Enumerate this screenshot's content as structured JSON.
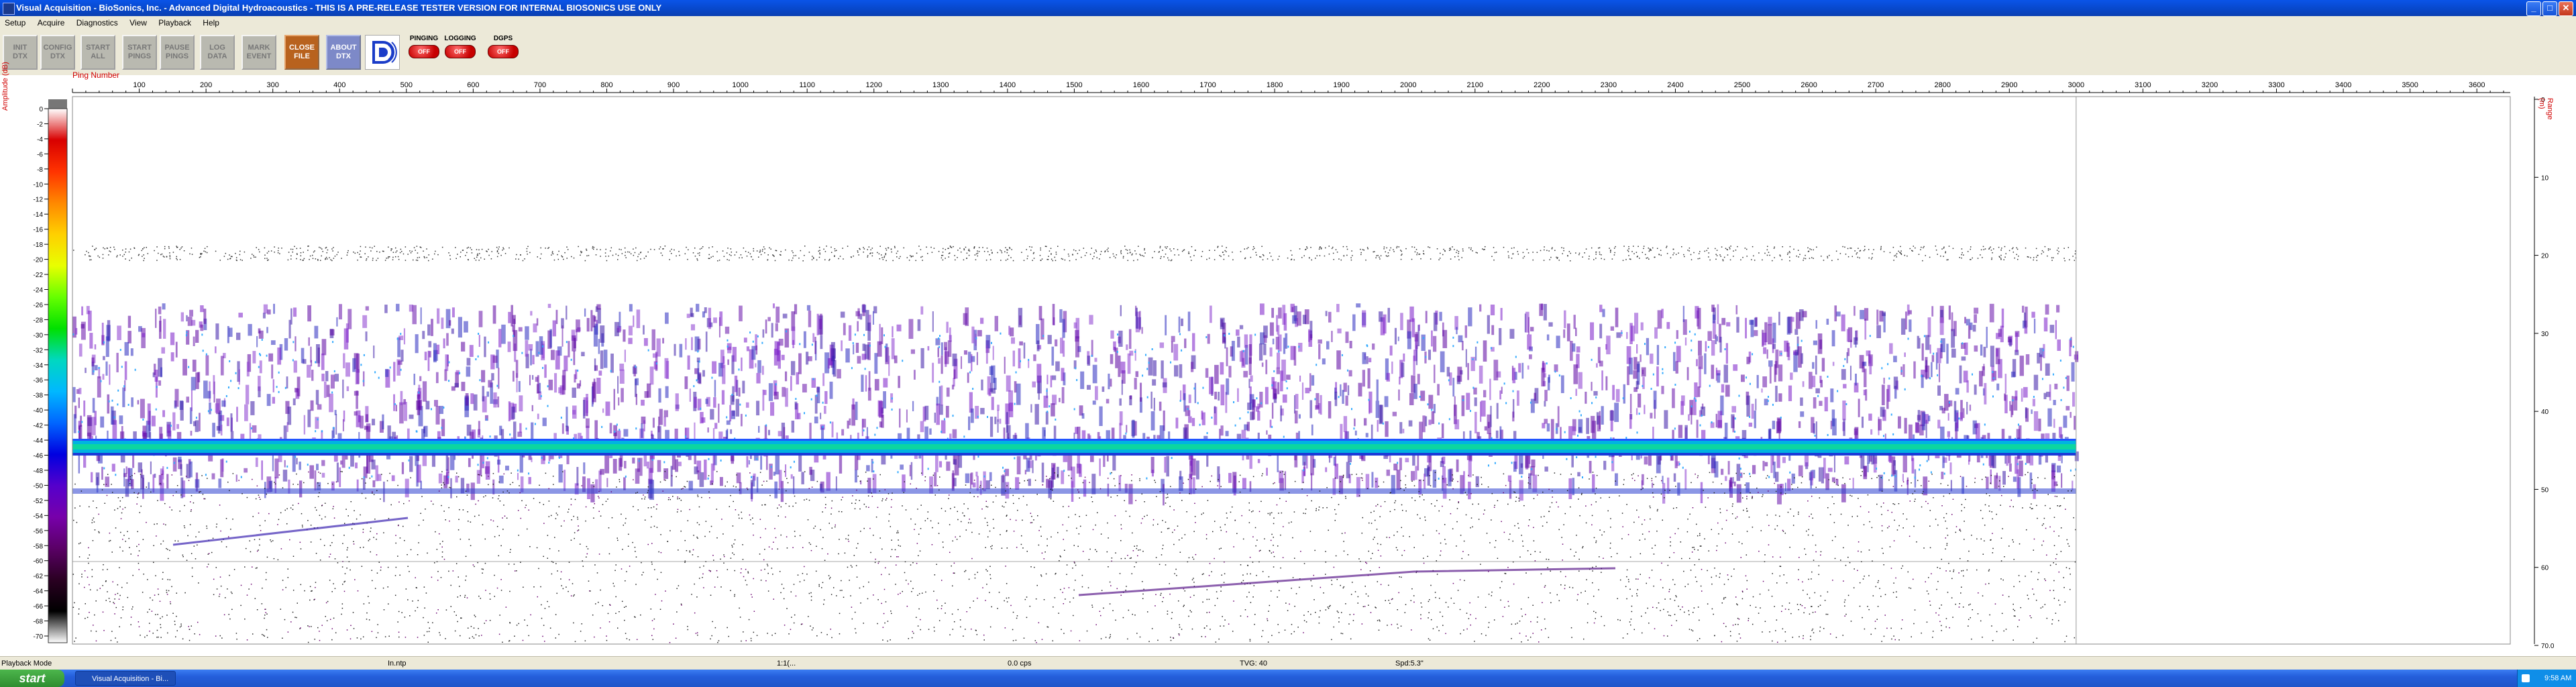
{
  "window": {
    "title": "Visual Acquisition  -  BioSonics, Inc.  -  Advanced Digital Hydroacoustics  -  THIS IS A PRE-RELEASE TESTER VERSION FOR INTERNAL BIOSONICS USE ONLY"
  },
  "menu": [
    "Setup",
    "Acquire",
    "Diagnostics",
    "View",
    "Playback",
    "Help"
  ],
  "toolbar": {
    "buttons": [
      {
        "label": "INIT\nDTX"
      },
      {
        "label": "CONFIG\nDTX"
      },
      {
        "label": "START\nALL"
      },
      {
        "label": "START\nPINGS"
      },
      {
        "label": "PAUSE\nPINGS"
      },
      {
        "label": "LOG\nDATA"
      },
      {
        "label": "MARK\nEVENT"
      },
      {
        "label": "CLOSE\nFILE"
      },
      {
        "label": "ABOUT\nDTX"
      }
    ],
    "indicators": [
      {
        "label": "PINGING",
        "state": "OFF"
      },
      {
        "label": "LOGGING",
        "state": "OFF"
      },
      {
        "label": "DGPS",
        "state": "OFF"
      }
    ]
  },
  "plot": {
    "x_title": "Ping Number",
    "left_title": "Amplitude (dB)",
    "right_title": "Range (m)",
    "x_ticks": [
      100,
      200,
      300,
      400,
      500,
      600,
      700,
      800,
      900,
      1000,
      1100,
      1200,
      1300,
      1400,
      1500,
      1600,
      1700,
      1800,
      1900,
      2000,
      2100,
      2200,
      2300,
      2400,
      2500,
      2600,
      2700,
      2800,
      2900,
      3000,
      3100,
      3200,
      3300,
      3400,
      3500,
      3600
    ],
    "amp_ticks": [
      "0",
      "-2",
      "-4",
      "-6",
      "-8",
      "-10",
      "-12",
      "-14",
      "-16",
      "-18",
      "-20",
      "-22",
      "-24",
      "-26",
      "-28",
      "-30",
      "-32",
      "-34",
      "-36",
      "-38",
      "-40",
      "-42",
      "-44",
      "-46",
      "-48",
      "-50",
      "-52",
      "-54",
      "-56",
      "-58",
      "-60",
      "-62",
      "-64",
      "-66",
      "-68",
      "-70"
    ],
    "range_ticks": [
      "0",
      "10",
      "20",
      "30",
      "40",
      "50",
      "60",
      "70.0"
    ],
    "colorbar": [
      "#ffffff",
      "#d80000",
      "#ff3300",
      "#ff8800",
      "#ffd000",
      "#e8ff00",
      "#66ff00",
      "#00e000",
      "#00d8c0",
      "#00b8ff",
      "#0066ff",
      "#0000e0",
      "#5500cc",
      "#7700aa",
      "#5a0066",
      "#2a0022",
      "#000000",
      "#ffffff"
    ],
    "x_range": [
      0,
      3650
    ],
    "ping_end": 3000
  },
  "status": {
    "mode": "Playback Mode",
    "field2": "In.ntp",
    "field3": "1:1(...",
    "field4": "0.0 cps",
    "field5": "TVG: 40",
    "field6": "Spd:5.3\""
  },
  "taskbar": {
    "start_label": "start",
    "task_label": "Visual Acquisition - Bi...",
    "clock": "9:58 AM"
  }
}
